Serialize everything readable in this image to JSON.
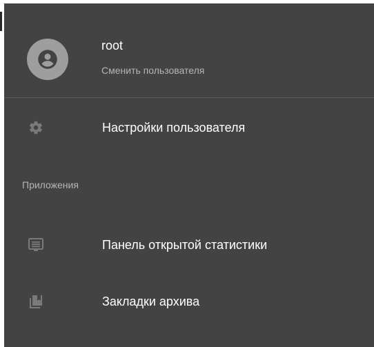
{
  "user": {
    "name": "root",
    "switch_label": "Сменить пользователя"
  },
  "menu": {
    "settings_label": "Настройки пользователя",
    "apps_section": "Приложения",
    "stats_label": "Панель открытой статистики",
    "bookmarks_label": "Закладки архива"
  },
  "icons": {
    "avatar": "account-circle-icon",
    "settings": "gear-icon",
    "stats": "monitor-list-icon",
    "bookmarks": "bookmark-archive-icon"
  },
  "colors": {
    "panel_bg": "#434343",
    "text_primary": "#ffffff",
    "text_secondary": "#b5b5b5",
    "icon_muted": "#7a7a7a",
    "avatar_bg": "#9e9e9e"
  }
}
